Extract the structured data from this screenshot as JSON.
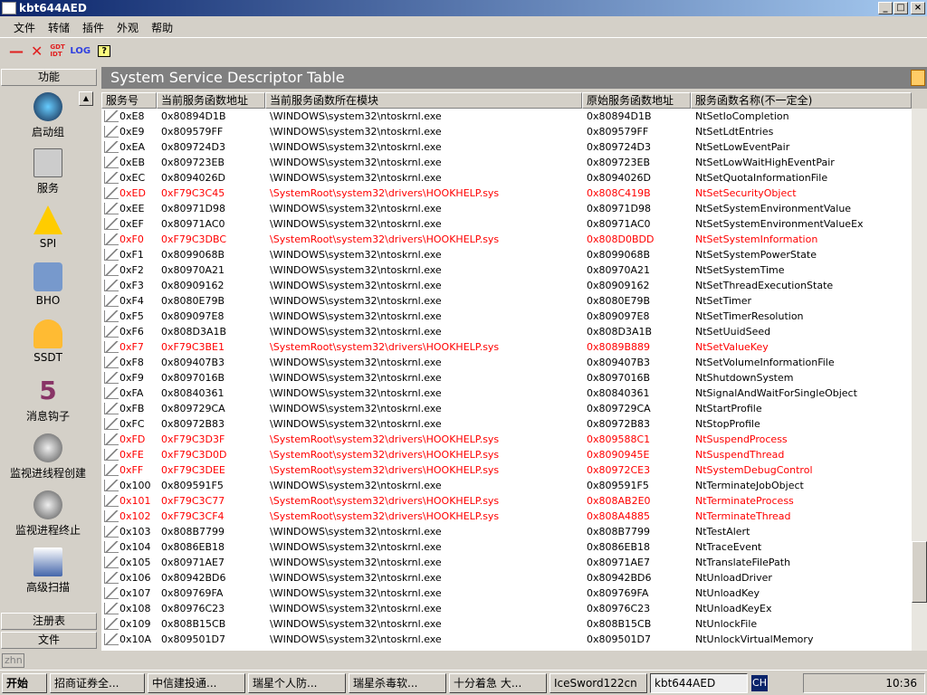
{
  "window": {
    "title": "kbt644AED"
  },
  "menu": [
    "文件",
    "转储",
    "插件",
    "外观",
    "帮助"
  ],
  "toolbar": {
    "gdt_idt": "GDT IDT",
    "log": "LOG"
  },
  "left": {
    "header": "功能",
    "items": [
      "启动组",
      "服务",
      "SPI",
      "BHO",
      "SSDT",
      "消息钩子",
      "监视进线程创建",
      "监视进程终止",
      "高级扫描"
    ],
    "bottom": [
      "注册表",
      "文件"
    ]
  },
  "main": {
    "title": "System Service Descriptor Table",
    "columns": [
      "服务号",
      "当前服务函数地址",
      "当前服务函数所在模块",
      "原始服务函数地址",
      "服务函数名称(不一定全)"
    ],
    "rows": [
      [
        "0xE8",
        "0x80894D1B",
        "\\WINDOWS\\system32\\ntoskrnl.exe",
        "0x80894D1B",
        "NtSetIoCompletion",
        0
      ],
      [
        "0xE9",
        "0x809579FF",
        "\\WINDOWS\\system32\\ntoskrnl.exe",
        "0x809579FF",
        "NtSetLdtEntries",
        0
      ],
      [
        "0xEA",
        "0x809724D3",
        "\\WINDOWS\\system32\\ntoskrnl.exe",
        "0x809724D3",
        "NtSetLowEventPair",
        0
      ],
      [
        "0xEB",
        "0x809723EB",
        "\\WINDOWS\\system32\\ntoskrnl.exe",
        "0x809723EB",
        "NtSetLowWaitHighEventPair",
        0
      ],
      [
        "0xEC",
        "0x8094026D",
        "\\WINDOWS\\system32\\ntoskrnl.exe",
        "0x8094026D",
        "NtSetQuotaInformationFile",
        0
      ],
      [
        "0xED",
        "0xF79C3C45",
        "\\SystemRoot\\system32\\drivers\\HOOKHELP.sys",
        "0x808C419B",
        "NtSetSecurityObject",
        1
      ],
      [
        "0xEE",
        "0x80971D98",
        "\\WINDOWS\\system32\\ntoskrnl.exe",
        "0x80971D98",
        "NtSetSystemEnvironmentValue",
        0
      ],
      [
        "0xEF",
        "0x80971AC0",
        "\\WINDOWS\\system32\\ntoskrnl.exe",
        "0x80971AC0",
        "NtSetSystemEnvironmentValueEx",
        0
      ],
      [
        "0xF0",
        "0xF79C3DBC",
        "\\SystemRoot\\system32\\drivers\\HOOKHELP.sys",
        "0x808D0BDD",
        "NtSetSystemInformation",
        1
      ],
      [
        "0xF1",
        "0x8099068B",
        "\\WINDOWS\\system32\\ntoskrnl.exe",
        "0x8099068B",
        "NtSetSystemPowerState",
        0
      ],
      [
        "0xF2",
        "0x80970A21",
        "\\WINDOWS\\system32\\ntoskrnl.exe",
        "0x80970A21",
        "NtSetSystemTime",
        0
      ],
      [
        "0xF3",
        "0x80909162",
        "\\WINDOWS\\system32\\ntoskrnl.exe",
        "0x80909162",
        "NtSetThreadExecutionState",
        0
      ],
      [
        "0xF4",
        "0x8080E79B",
        "\\WINDOWS\\system32\\ntoskrnl.exe",
        "0x8080E79B",
        "NtSetTimer",
        0
      ],
      [
        "0xF5",
        "0x809097E8",
        "\\WINDOWS\\system32\\ntoskrnl.exe",
        "0x809097E8",
        "NtSetTimerResolution",
        0
      ],
      [
        "0xF6",
        "0x808D3A1B",
        "\\WINDOWS\\system32\\ntoskrnl.exe",
        "0x808D3A1B",
        "NtSetUuidSeed",
        0
      ],
      [
        "0xF7",
        "0xF79C3BE1",
        "\\SystemRoot\\system32\\drivers\\HOOKHELP.sys",
        "0x8089B889",
        "NtSetValueKey",
        1
      ],
      [
        "0xF8",
        "0x809407B3",
        "\\WINDOWS\\system32\\ntoskrnl.exe",
        "0x809407B3",
        "NtSetVolumeInformationFile",
        0
      ],
      [
        "0xF9",
        "0x8097016B",
        "\\WINDOWS\\system32\\ntoskrnl.exe",
        "0x8097016B",
        "NtShutdownSystem",
        0
      ],
      [
        "0xFA",
        "0x80840361",
        "\\WINDOWS\\system32\\ntoskrnl.exe",
        "0x80840361",
        "NtSignalAndWaitForSingleObject",
        0
      ],
      [
        "0xFB",
        "0x809729CA",
        "\\WINDOWS\\system32\\ntoskrnl.exe",
        "0x809729CA",
        "NtStartProfile",
        0
      ],
      [
        "0xFC",
        "0x80972B83",
        "\\WINDOWS\\system32\\ntoskrnl.exe",
        "0x80972B83",
        "NtStopProfile",
        0
      ],
      [
        "0xFD",
        "0xF79C3D3F",
        "\\SystemRoot\\system32\\drivers\\HOOKHELP.sys",
        "0x809588C1",
        "NtSuspendProcess",
        1
      ],
      [
        "0xFE",
        "0xF79C3D0D",
        "\\SystemRoot\\system32\\drivers\\HOOKHELP.sys",
        "0x8090945E",
        "NtSuspendThread",
        1
      ],
      [
        "0xFF",
        "0xF79C3DEE",
        "\\SystemRoot\\system32\\drivers\\HOOKHELP.sys",
        "0x80972CE3",
        "NtSystemDebugControl",
        1
      ],
      [
        "0x100",
        "0x809591F5",
        "\\WINDOWS\\system32\\ntoskrnl.exe",
        "0x809591F5",
        "NtTerminateJobObject",
        0
      ],
      [
        "0x101",
        "0xF79C3C77",
        "\\SystemRoot\\system32\\drivers\\HOOKHELP.sys",
        "0x808AB2E0",
        "NtTerminateProcess",
        1
      ],
      [
        "0x102",
        "0xF79C3CF4",
        "\\SystemRoot\\system32\\drivers\\HOOKHELP.sys",
        "0x808A4885",
        "NtTerminateThread",
        1
      ],
      [
        "0x103",
        "0x808B7799",
        "\\WINDOWS\\system32\\ntoskrnl.exe",
        "0x808B7799",
        "NtTestAlert",
        0
      ],
      [
        "0x104",
        "0x8086EB18",
        "\\WINDOWS\\system32\\ntoskrnl.exe",
        "0x8086EB18",
        "NtTraceEvent",
        0
      ],
      [
        "0x105",
        "0x80971AE7",
        "\\WINDOWS\\system32\\ntoskrnl.exe",
        "0x80971AE7",
        "NtTranslateFilePath",
        0
      ],
      [
        "0x106",
        "0x80942BD6",
        "\\WINDOWS\\system32\\ntoskrnl.exe",
        "0x80942BD6",
        "NtUnloadDriver",
        0
      ],
      [
        "0x107",
        "0x809769FA",
        "\\WINDOWS\\system32\\ntoskrnl.exe",
        "0x809769FA",
        "NtUnloadKey",
        0
      ],
      [
        "0x108",
        "0x80976C23",
        "\\WINDOWS\\system32\\ntoskrnl.exe",
        "0x80976C23",
        "NtUnloadKeyEx",
        0
      ],
      [
        "0x109",
        "0x808B15CB",
        "\\WINDOWS\\system32\\ntoskrnl.exe",
        "0x808B15CB",
        "NtUnlockFile",
        0
      ],
      [
        "0x10A",
        "0x809501D7",
        "\\WINDOWS\\system32\\ntoskrnl.exe",
        "0x809501D7",
        "NtUnlockVirtualMemory",
        0
      ]
    ]
  },
  "status": {
    "text": "zhn"
  },
  "taskbar": {
    "start": "开始",
    "items": [
      "招商证券全...",
      "中信建投通...",
      "瑞星个人防...",
      "瑞星杀毒软...",
      "十分着急 大...",
      "IceSword122cn",
      "kbt644AED"
    ],
    "lang": "CH",
    "clock": "10:36"
  },
  "colors": {
    "hooked": "#ff0000",
    "title_bar": "#0a246a"
  }
}
